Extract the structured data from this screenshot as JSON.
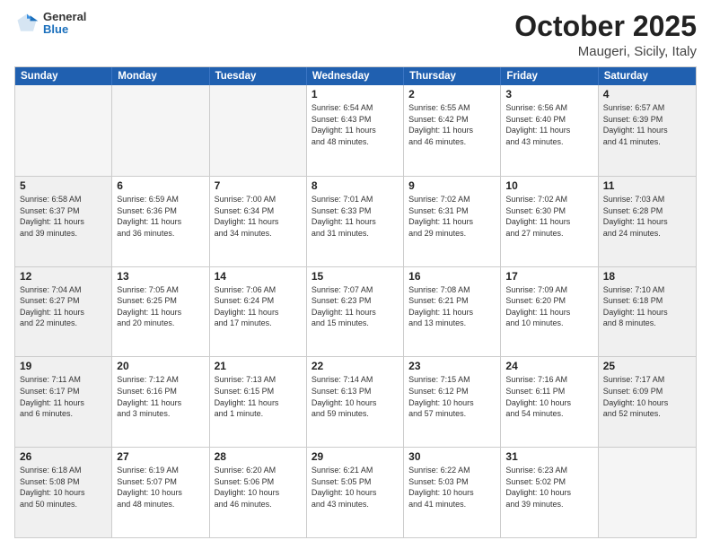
{
  "header": {
    "logo": {
      "general": "General",
      "blue": "Blue"
    },
    "title": "October 2025",
    "location": "Maugeri, Sicily, Italy"
  },
  "weekdays": [
    "Sunday",
    "Monday",
    "Tuesday",
    "Wednesday",
    "Thursday",
    "Friday",
    "Saturday"
  ],
  "rows": [
    [
      {
        "day": "",
        "text": "",
        "empty": true
      },
      {
        "day": "",
        "text": "",
        "empty": true
      },
      {
        "day": "",
        "text": "",
        "empty": true
      },
      {
        "day": "1",
        "text": "Sunrise: 6:54 AM\nSunset: 6:43 PM\nDaylight: 11 hours\nand 48 minutes.",
        "empty": false
      },
      {
        "day": "2",
        "text": "Sunrise: 6:55 AM\nSunset: 6:42 PM\nDaylight: 11 hours\nand 46 minutes.",
        "empty": false
      },
      {
        "day": "3",
        "text": "Sunrise: 6:56 AM\nSunset: 6:40 PM\nDaylight: 11 hours\nand 43 minutes.",
        "empty": false
      },
      {
        "day": "4",
        "text": "Sunrise: 6:57 AM\nSunset: 6:39 PM\nDaylight: 11 hours\nand 41 minutes.",
        "empty": false,
        "shaded": true
      }
    ],
    [
      {
        "day": "5",
        "text": "Sunrise: 6:58 AM\nSunset: 6:37 PM\nDaylight: 11 hours\nand 39 minutes.",
        "empty": false,
        "shaded": true
      },
      {
        "day": "6",
        "text": "Sunrise: 6:59 AM\nSunset: 6:36 PM\nDaylight: 11 hours\nand 36 minutes.",
        "empty": false
      },
      {
        "day": "7",
        "text": "Sunrise: 7:00 AM\nSunset: 6:34 PM\nDaylight: 11 hours\nand 34 minutes.",
        "empty": false
      },
      {
        "day": "8",
        "text": "Sunrise: 7:01 AM\nSunset: 6:33 PM\nDaylight: 11 hours\nand 31 minutes.",
        "empty": false
      },
      {
        "day": "9",
        "text": "Sunrise: 7:02 AM\nSunset: 6:31 PM\nDaylight: 11 hours\nand 29 minutes.",
        "empty": false
      },
      {
        "day": "10",
        "text": "Sunrise: 7:02 AM\nSunset: 6:30 PM\nDaylight: 11 hours\nand 27 minutes.",
        "empty": false
      },
      {
        "day": "11",
        "text": "Sunrise: 7:03 AM\nSunset: 6:28 PM\nDaylight: 11 hours\nand 24 minutes.",
        "empty": false,
        "shaded": true
      }
    ],
    [
      {
        "day": "12",
        "text": "Sunrise: 7:04 AM\nSunset: 6:27 PM\nDaylight: 11 hours\nand 22 minutes.",
        "empty": false,
        "shaded": true
      },
      {
        "day": "13",
        "text": "Sunrise: 7:05 AM\nSunset: 6:25 PM\nDaylight: 11 hours\nand 20 minutes.",
        "empty": false
      },
      {
        "day": "14",
        "text": "Sunrise: 7:06 AM\nSunset: 6:24 PM\nDaylight: 11 hours\nand 17 minutes.",
        "empty": false
      },
      {
        "day": "15",
        "text": "Sunrise: 7:07 AM\nSunset: 6:23 PM\nDaylight: 11 hours\nand 15 minutes.",
        "empty": false
      },
      {
        "day": "16",
        "text": "Sunrise: 7:08 AM\nSunset: 6:21 PM\nDaylight: 11 hours\nand 13 minutes.",
        "empty": false
      },
      {
        "day": "17",
        "text": "Sunrise: 7:09 AM\nSunset: 6:20 PM\nDaylight: 11 hours\nand 10 minutes.",
        "empty": false
      },
      {
        "day": "18",
        "text": "Sunrise: 7:10 AM\nSunset: 6:18 PM\nDaylight: 11 hours\nand 8 minutes.",
        "empty": false,
        "shaded": true
      }
    ],
    [
      {
        "day": "19",
        "text": "Sunrise: 7:11 AM\nSunset: 6:17 PM\nDaylight: 11 hours\nand 6 minutes.",
        "empty": false,
        "shaded": true
      },
      {
        "day": "20",
        "text": "Sunrise: 7:12 AM\nSunset: 6:16 PM\nDaylight: 11 hours\nand 3 minutes.",
        "empty": false
      },
      {
        "day": "21",
        "text": "Sunrise: 7:13 AM\nSunset: 6:15 PM\nDaylight: 11 hours\nand 1 minute.",
        "empty": false
      },
      {
        "day": "22",
        "text": "Sunrise: 7:14 AM\nSunset: 6:13 PM\nDaylight: 10 hours\nand 59 minutes.",
        "empty": false
      },
      {
        "day": "23",
        "text": "Sunrise: 7:15 AM\nSunset: 6:12 PM\nDaylight: 10 hours\nand 57 minutes.",
        "empty": false
      },
      {
        "day": "24",
        "text": "Sunrise: 7:16 AM\nSunset: 6:11 PM\nDaylight: 10 hours\nand 54 minutes.",
        "empty": false
      },
      {
        "day": "25",
        "text": "Sunrise: 7:17 AM\nSunset: 6:09 PM\nDaylight: 10 hours\nand 52 minutes.",
        "empty": false,
        "shaded": true
      }
    ],
    [
      {
        "day": "26",
        "text": "Sunrise: 6:18 AM\nSunset: 5:08 PM\nDaylight: 10 hours\nand 50 minutes.",
        "empty": false,
        "shaded": true
      },
      {
        "day": "27",
        "text": "Sunrise: 6:19 AM\nSunset: 5:07 PM\nDaylight: 10 hours\nand 48 minutes.",
        "empty": false
      },
      {
        "day": "28",
        "text": "Sunrise: 6:20 AM\nSunset: 5:06 PM\nDaylight: 10 hours\nand 46 minutes.",
        "empty": false
      },
      {
        "day": "29",
        "text": "Sunrise: 6:21 AM\nSunset: 5:05 PM\nDaylight: 10 hours\nand 43 minutes.",
        "empty": false
      },
      {
        "day": "30",
        "text": "Sunrise: 6:22 AM\nSunset: 5:03 PM\nDaylight: 10 hours\nand 41 minutes.",
        "empty": false
      },
      {
        "day": "31",
        "text": "Sunrise: 6:23 AM\nSunset: 5:02 PM\nDaylight: 10 hours\nand 39 minutes.",
        "empty": false
      },
      {
        "day": "",
        "text": "",
        "empty": true,
        "shaded": true
      }
    ]
  ]
}
